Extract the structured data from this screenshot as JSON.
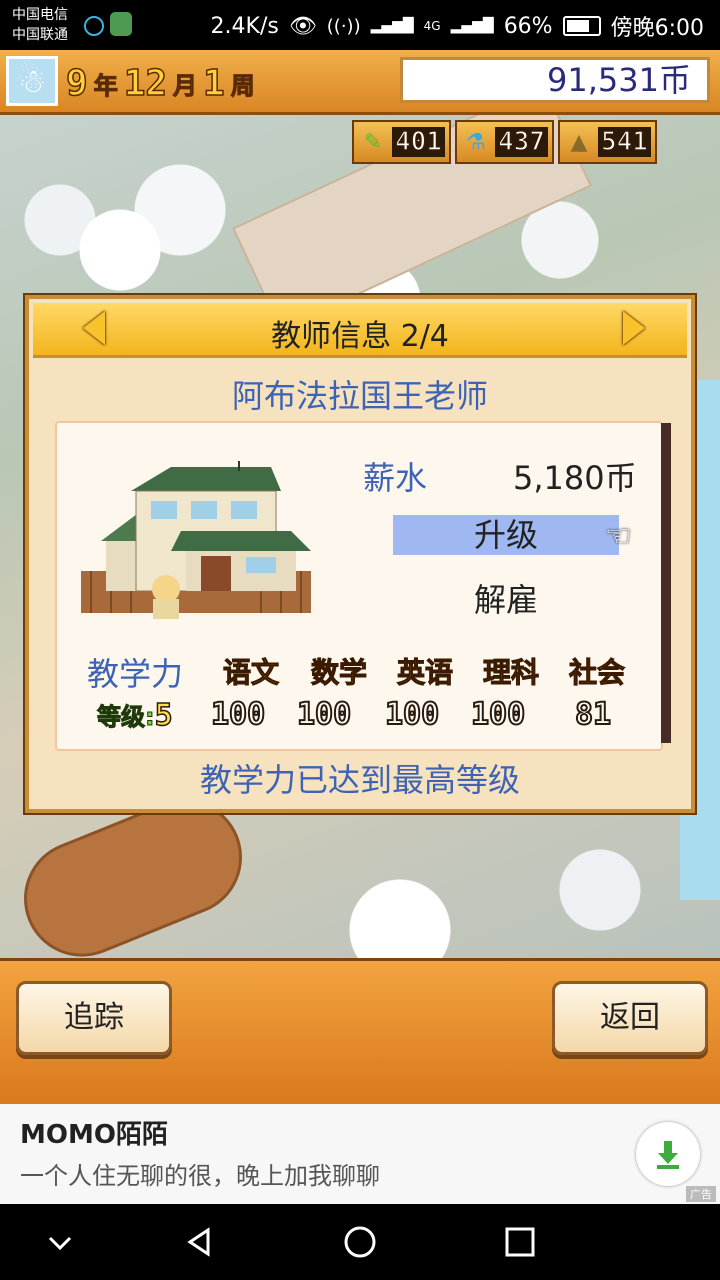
{
  "status_bar": {
    "carrier1": "中国电信",
    "carrier2": "中国联通",
    "speed": "2.4K/s",
    "network": "4G",
    "battery": "66%",
    "time": "傍晚6:00"
  },
  "header": {
    "year_value": "9",
    "year_unit": "年",
    "month_value": "12",
    "month_unit": "月",
    "week_value": "1",
    "week_unit": "周",
    "money": "91,531币"
  },
  "resources": [
    {
      "icon": "pencil-icon",
      "value": "401"
    },
    {
      "icon": "flask-icon",
      "value": "437"
    },
    {
      "icon": "pyramid-icon",
      "value": "541"
    }
  ],
  "dialog": {
    "title": "教师信息 2/4",
    "teacher_name": "阿布法拉国王老师",
    "salary_label": "薪水",
    "salary_value": "5,180币",
    "upgrade_label": "升级",
    "fire_label": "解雇",
    "power_label": "教学力",
    "level_label": "等级:",
    "level_value": "5",
    "subjects": [
      {
        "name": "语文",
        "score": "100"
      },
      {
        "name": "数学",
        "score": "100"
      },
      {
        "name": "英语",
        "score": "100"
      },
      {
        "name": "理科",
        "score": "100"
      },
      {
        "name": "社会",
        "score": "81"
      }
    ],
    "footer_message": "教学力已达到最高等级"
  },
  "bottom": {
    "track_label": "追踪",
    "back_label": "返回"
  },
  "ad": {
    "title": "MOMO陌陌",
    "text": "一个人住无聊的很，晚上加我聊聊",
    "tag": "广告"
  },
  "colors": {
    "accent_blue": "#3d63b4",
    "dialog_bg": "#f7e2bf",
    "header_orange": "#d98624",
    "highlight": "#9fb8f2"
  }
}
